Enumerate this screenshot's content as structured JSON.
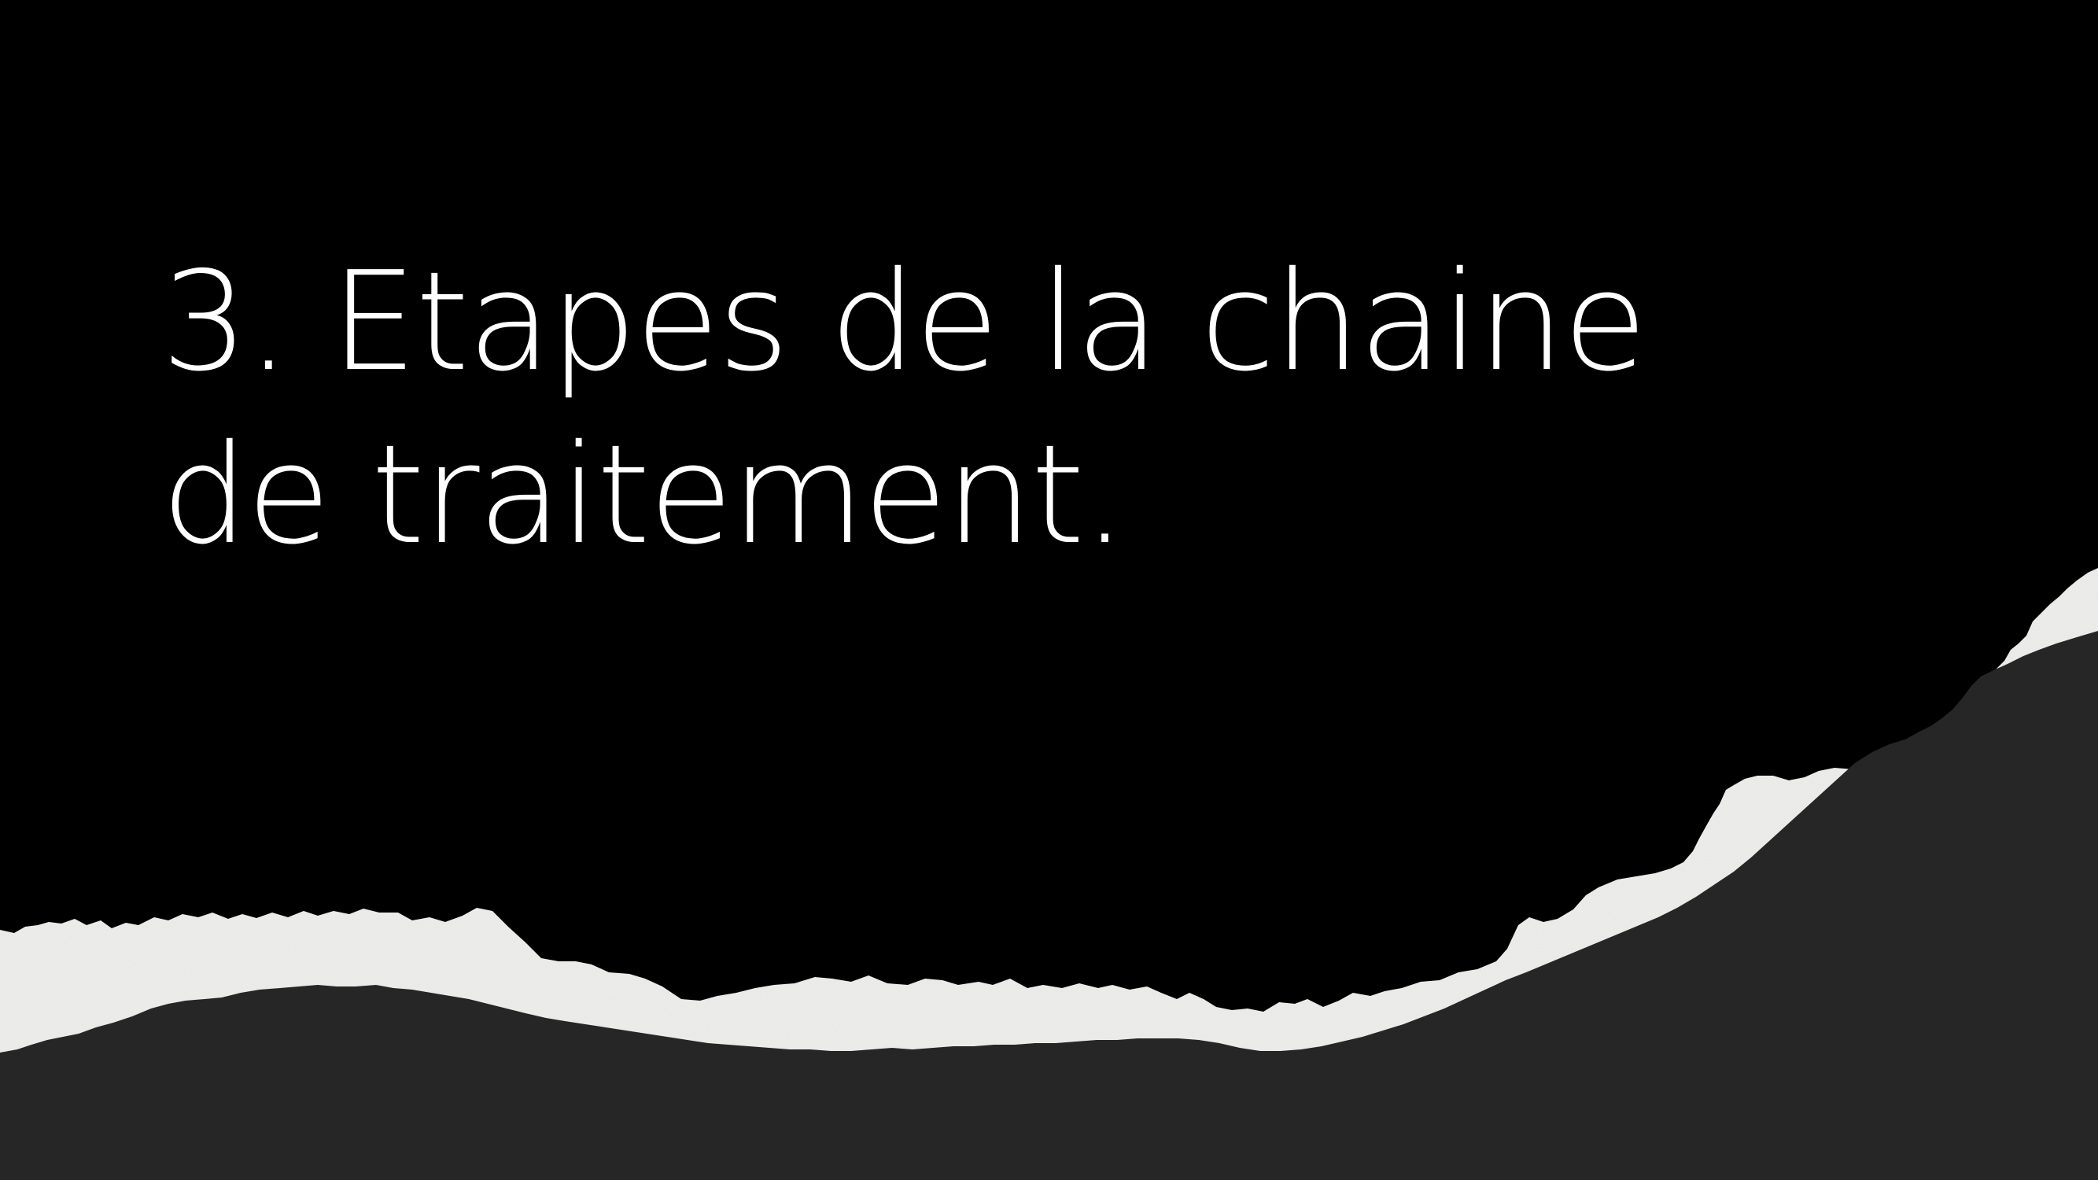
{
  "slide": {
    "title_lines": [
      "3. Etapes de la chaine",
      "de traitement."
    ]
  },
  "colors": {
    "background": "#000000",
    "title_text": "#ffffff",
    "torn_paper": "#efefed",
    "bottom_band": "#262626"
  }
}
